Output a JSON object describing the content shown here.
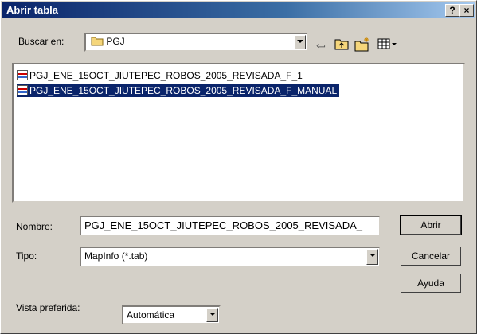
{
  "window": {
    "title": "Abrir tabla",
    "help_label": "?",
    "close_label": "×"
  },
  "lookin": {
    "label": "Buscar en:",
    "value": "PGJ"
  },
  "toolbar": {
    "back_icon": "⇦",
    "up_icon": "up-folder-icon",
    "newfolder_icon": "new-folder-icon",
    "view_icon": "view-menu-icon"
  },
  "files": [
    {
      "name": "PGJ_ENE_15OCT_JIUTEPEC_ROBOS_2005_REVISADA_F_1",
      "selected": false
    },
    {
      "name": "PGJ_ENE_15OCT_JIUTEPEC_ROBOS_2005_REVISADA_F_MANUAL",
      "selected": true
    }
  ],
  "filename": {
    "label": "Nombre:",
    "value": "PGJ_ENE_15OCT_JIUTEPEC_ROBOS_2005_REVISADA_"
  },
  "filetype": {
    "label": "Tipo:",
    "value": "MapInfo (*.tab)"
  },
  "preferred_view": {
    "label": "Vista preferida:",
    "value": "Automática"
  },
  "buttons": {
    "open": "Abrir",
    "cancel": "Cancelar",
    "help": "Ayuda"
  }
}
